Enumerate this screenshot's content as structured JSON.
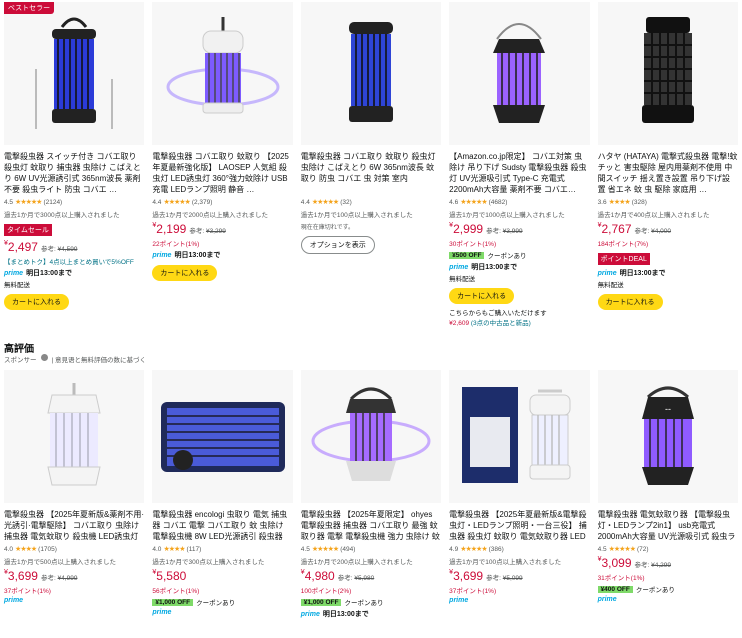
{
  "best_seller_badge": "ベストセラー",
  "section": {
    "title": "高評価",
    "sponsor": "スポンサー",
    "info_icon": "info-icon",
    "note": "| 意見语と無料評価の数に基づく"
  },
  "row1": [
    {
      "title": "電撃殺虫器 スイッチ付き コバエ取り 殺虫灯 蚊取り 捕虫器 虫除け こばえとり 6W UV光源誘引式 365nm波長 薬剤不要 殺虫ライト 防虫 コバエ …",
      "rating": "4.5",
      "stars": "★★★★★",
      "reviews": "(2124)",
      "bought": "過去1か月で3000点以上購入されました",
      "deal": "タイムセール",
      "price_yen": "¥",
      "price": "2,497",
      "ref_label": "参考:",
      "ref_price": "¥4,599",
      "points": "【まとめトク】4点以上まとめ買いで5%OFF",
      "prime": "prime",
      "delivery": "明日13:00まで",
      "free": "無料配送",
      "cart": "カートに入れる"
    },
    {
      "title": "電撃殺虫器 コバエ取り 蚊取り 【2025年夏最新強化版】 LAOSEP 人気組 殺虫灯 LED誘虫灯 360°強力蚊除け USB充電 LEDランプ照明 静音 …",
      "rating": "4.4",
      "stars": "★★★★★",
      "reviews": "(2,379)",
      "bought": "過去1か月で2000点以上購入されました",
      "price_yen": "¥",
      "price": "2,199",
      "ref_label": "参考:",
      "ref_price": "¥3,299",
      "points": "22ポイント(1%)",
      "prime": "prime",
      "delivery": "明日13:00まで",
      "cart": "カートに入れる"
    },
    {
      "title": "電撃殺虫器 コバエ取り 蚊取り 殺虫灯 虫除け こばえとり 6W 365nm波長 蚊取り 防虫 コバエ 虫 対策 室内",
      "rating": "4.4",
      "stars": "★★★★★",
      "reviews": "(32)",
      "bought": "過去1か月で100点以上購入されました",
      "note": "現在在庫切れです。",
      "options_btn": "オプションを表示"
    },
    {
      "title": "【Amazon.co.jp限定】 コバエ対策 虫除け 吊り下げ Sudsty 電撃殺虫器 殺虫灯 UV光源吸引式 Type-C 充電式 2200mAh大容量 薬剤不要 コバエ…",
      "rating": "4.6",
      "stars": "★★★★★",
      "reviews": "(4682)",
      "bought": "過去1か月で1000点以上購入されました",
      "price_yen": "¥",
      "price": "2,999",
      "ref_label": "参考:",
      "ref_price": "¥3,999",
      "points": "30ポイント(1%)",
      "coupon_tag": "¥500 OFF",
      "coupon_text": "クーポンあり",
      "prime": "prime",
      "delivery": "明日13:00まで",
      "free": "無料配送",
      "cart": "カートに入れる",
      "offer_line": "こちらからもご購入いただけます",
      "offer_price": "¥2,609",
      "offer_link": "(3点の中古品と新品)"
    },
    {
      "title": "ハタヤ (HATAYA) 電撃式殺虫器 電撃!蚊チッと 害虫駆除 屋内用薬剤不使用 中間スイッチ 揺え置き設置 吊り下げ設置 省エネ 蚊 虫 駆除 家庭用 …",
      "rating": "3.6",
      "stars": "★★★★",
      "reviews": "(328)",
      "bought": "過去1か月で400点以上購入されました",
      "price_yen": "¥",
      "price": "2,767",
      "ref_label": "参考:",
      "ref_price": "¥4,000",
      "points": "184ポイント(7%)",
      "deal": "ポイントDEAL",
      "prime": "prime",
      "delivery": "明日13:00まで",
      "free": "無料配送",
      "cart": "カートに入れる"
    }
  ],
  "row2": [
    {
      "title": "電撃殺虫器 【2025年夏新版&薬剤不用·光誘引·電撃駆除】 コバエ取り 虫除け 捕虫器 電気蚊取り 殺虫機 LED誘虫灯 LEDランプ照明灯付き …",
      "rating": "4.0",
      "stars": "★★★★",
      "reviews": "(1705)",
      "bought": "過去1か月で500点以上購入されました",
      "price_yen": "¥",
      "price": "3,699",
      "ref_label": "参考:",
      "ref_price": "¥4,999",
      "points": "37ポイント(1%)",
      "prime": "prime"
    },
    {
      "title": "電撃殺虫器 encologi 虫取り 電気 捕虫器 コバエ 電撃 コバエ取り 蚊 虫除け 電撃殺虫機 8W LED光源誘引 殺虫器 捕虫器 蚊 退治 強力 虫 電気 …",
      "rating": "4.0",
      "stars": "★★★★",
      "reviews": "(117)",
      "bought": "過去1か月で300点以上購入されました",
      "price_yen": "¥",
      "price": "5,580",
      "points": "56ポイント(1%)",
      "coupon_tag": "¥1,000 OFF",
      "coupon_text": "クーポンあり",
      "prime": "prime"
    },
    {
      "title": "電撃殺虫器 【2025年夏限定】 ohyes 電撃殺虫器 捕虫器 コバエ取り 最強 蚊取り器 電撃 電撃殺虫機 強力 虫除け 蚊取りライト 360°強力蚊除け …",
      "rating": "4.5",
      "stars": "★★★★★",
      "reviews": "(494)",
      "bought": "過去1か月で200点以上購入されました",
      "price_yen": "¥",
      "price": "4,980",
      "ref_label": "参考:",
      "ref_price": "¥5,980",
      "points": "100ポイント(2%)",
      "coupon_tag": "¥1,000 OFF",
      "coupon_text": "クーポンあり",
      "prime": "prime",
      "delivery": "明日13:00まで"
    },
    {
      "title": "電撃殺虫器 【2025年夏最新版&電撃殺虫灯・LEDランプ照明・一台三役】 捕虫器 殺虫灯 蚊取り 電気蚊取り器 LED誘虫灯 大容量 …",
      "rating": "4.9",
      "stars": "★★★★★",
      "reviews": "(386)",
      "bought": "過去1か月で100点以上購入されました",
      "price_yen": "¥",
      "price": "3,699",
      "ref_label": "参考:",
      "ref_price": "¥5,099",
      "points": "37ポイント(1%)",
      "prime": "prime"
    },
    {
      "title": "電撃殺虫器 電気蚊取り器 【電撃殺虫灯・LEDランプ2in1】 usb充電式 2000mAh大容量 UV光源吸引式 殺虫ライト LED誘虫灯 薬剤不用 蚊除け …",
      "rating": "4.5",
      "stars": "★★★★★",
      "reviews": "(72)",
      "bought": "",
      "price_yen": "¥",
      "price": "3,099",
      "ref_label": "参考:",
      "ref_price": "¥4,299",
      "points": "31ポイント(1%)",
      "coupon_tag": "¥400 OFF",
      "coupon_text": "クーポンあり",
      "prime": "prime"
    }
  ]
}
